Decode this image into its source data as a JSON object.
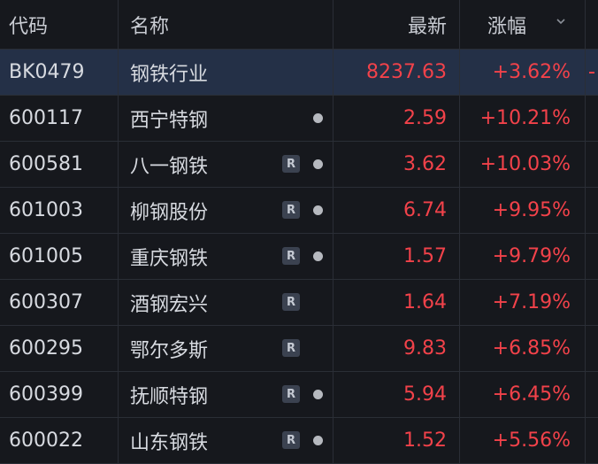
{
  "header": {
    "code": "代码",
    "name": "名称",
    "last": "最新",
    "change": "涨幅"
  },
  "icons": {
    "sort": "chevron-down-icon",
    "r_badge": "R",
    "dot": "dot-icon"
  },
  "colors": {
    "up": "#f2424a",
    "selected_row": "#243047",
    "background": "#16181d"
  },
  "rows": [
    {
      "code": "BK0479",
      "name": "钢铁行业",
      "last": "8237.63",
      "change": "+3.62%",
      "badge": false,
      "dot": false,
      "selected": true
    },
    {
      "code": "600117",
      "name": "西宁特钢",
      "last": "2.59",
      "change": "+10.21%",
      "badge": false,
      "dot": true,
      "selected": false
    },
    {
      "code": "600581",
      "name": "八一钢铁",
      "last": "3.62",
      "change": "+10.03%",
      "badge": true,
      "dot": true,
      "selected": false
    },
    {
      "code": "601003",
      "name": "柳钢股份",
      "last": "6.74",
      "change": "+9.95%",
      "badge": true,
      "dot": true,
      "selected": false
    },
    {
      "code": "601005",
      "name": "重庆钢铁",
      "last": "1.57",
      "change": "+9.79%",
      "badge": true,
      "dot": true,
      "selected": false
    },
    {
      "code": "600307",
      "name": "酒钢宏兴",
      "last": "1.64",
      "change": "+7.19%",
      "badge": true,
      "dot": false,
      "selected": false
    },
    {
      "code": "600295",
      "name": "鄂尔多斯",
      "last": "9.83",
      "change": "+6.85%",
      "badge": true,
      "dot": false,
      "selected": false
    },
    {
      "code": "600399",
      "name": "抚顺特钢",
      "last": "5.94",
      "change": "+6.45%",
      "badge": true,
      "dot": true,
      "selected": false
    },
    {
      "code": "600022",
      "name": "山东钢铁",
      "last": "1.52",
      "change": "+5.56%",
      "badge": true,
      "dot": true,
      "selected": false
    }
  ]
}
